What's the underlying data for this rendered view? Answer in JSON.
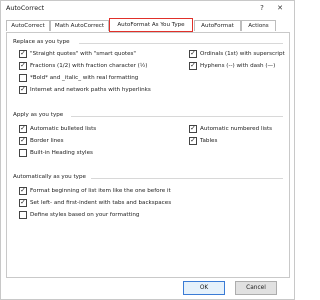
{
  "window": {
    "title": "AutoCorrect",
    "help_glyph": "?",
    "close_glyph": "✕"
  },
  "tabs": [
    {
      "label": "AutoCorrect"
    },
    {
      "label": "Math AutoCorrect"
    },
    {
      "label": "AutoFormat As You Type",
      "active": true
    },
    {
      "label": "AutoFormat"
    },
    {
      "label": "Actions"
    }
  ],
  "replace_group": {
    "label": "Replace as you type",
    "left": [
      {
        "label": "\"Straight quotes\" with \"smart quotes\"",
        "checked": true
      },
      {
        "label": "Fractions (1/2) with fraction character (½)",
        "checked": true
      },
      {
        "label": "*Bold* and _italic_ with real formatting",
        "checked": false
      },
      {
        "label": "Internet and network paths with hyperlinks",
        "checked": true
      }
    ],
    "right": [
      {
        "label": "Ordinals (1st) with superscript",
        "checked": true
      },
      {
        "label": "Hyphens (--) with dash (—)",
        "checked": true
      }
    ]
  },
  "apply_group": {
    "label": "Apply as you type",
    "left": [
      {
        "label": "Automatic bulleted lists",
        "checked": true
      },
      {
        "label": "Border lines",
        "checked": true
      },
      {
        "label": "Built-in Heading styles",
        "checked": false
      }
    ],
    "right": [
      {
        "label": "Automatic numbered lists",
        "checked": true
      },
      {
        "label": "Tables",
        "checked": true
      }
    ]
  },
  "auto_group": {
    "label": "Automatically as you type",
    "items": [
      {
        "label": "Format beginning of list item like the one before it",
        "checked": true
      },
      {
        "label": "Set left- and first-indent with tabs and backspaces",
        "checked": true
      },
      {
        "label": "Define styles based on your formatting",
        "checked": false
      }
    ]
  },
  "buttons": {
    "ok": "OK",
    "cancel": "Cancel"
  },
  "check_glyph": "✓"
}
